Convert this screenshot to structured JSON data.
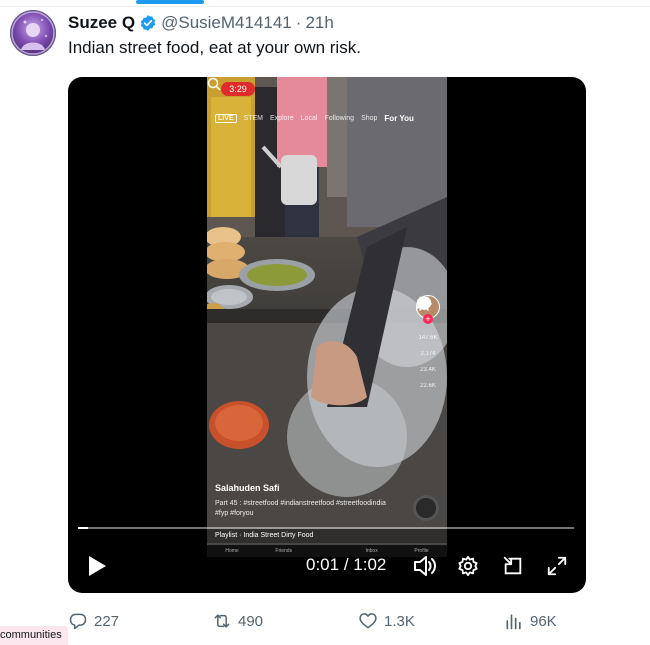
{
  "tweet": {
    "display_name": "Suzee Q",
    "handle": "@SusieM414141",
    "separator": "·",
    "time": "21h",
    "text": "Indian street food, eat at your own risk."
  },
  "video": {
    "current_time": "0:01",
    "duration": "1:02",
    "time_separator": " / ",
    "progress": 0.02,
    "tiktok_overlay": {
      "clock": "3:29",
      "live_label": "LIVE",
      "nav_tabs": [
        "STEM",
        "Explore",
        "Local",
        "Following",
        "Shop",
        "For You"
      ],
      "active_tab": "For You",
      "likes": "147.6K",
      "comments": "2,174",
      "saves": "23.4K",
      "shares": "22.6K",
      "creator": "Salahuden Safi",
      "caption": "Part 45 : #streetfood #indianstreetfood #streetfoodindia #fyp #foryou",
      "playlist": "Playlist · India Street Dirty Food",
      "bottom_nav": [
        "Home",
        "Friends",
        "",
        "Inbox",
        "Profile"
      ]
    }
  },
  "actions": {
    "replies": "227",
    "reposts": "490",
    "likes": "1.3K",
    "views": "96K"
  },
  "footer_chip": "communities",
  "colors": {
    "accent": "#1d9bf0",
    "muted": "#536471",
    "text": "#0f1419",
    "chip_bg": "#fde7ee"
  }
}
